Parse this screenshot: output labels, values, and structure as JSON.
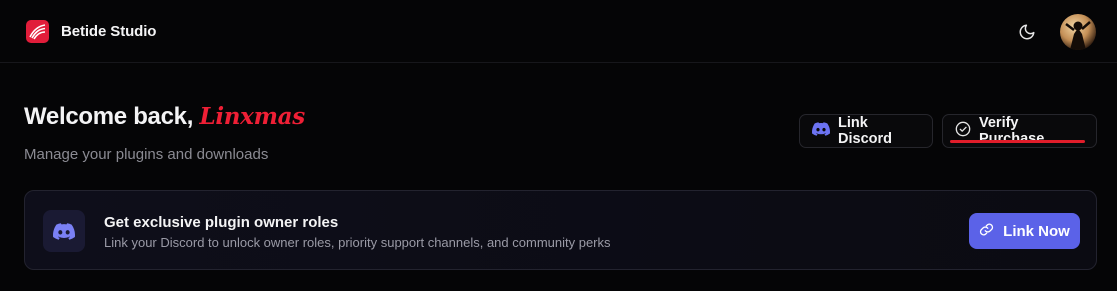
{
  "header": {
    "brand": "Betide Studio",
    "icons": {
      "logo": "betide-logo-icon",
      "theme": "moon-icon",
      "avatar": "user-avatar"
    },
    "brand_color": "#e11d3a"
  },
  "welcome": {
    "greeting": "Welcome back,",
    "username": "Linxmas",
    "subtitle": "Manage your plugins and downloads",
    "username_color": "#ef1f35"
  },
  "actions": {
    "link_discord_label": "Link Discord",
    "verify_purchase_label": "Verify Purchase",
    "icons": {
      "discord": "discord-icon",
      "verify": "check-circle-icon"
    }
  },
  "banner": {
    "title": "Get exclusive plugin owner roles",
    "description": "Link your Discord to unlock owner roles, priority support channels, and community perks",
    "button_label": "Link Now",
    "button_color": "#5b62e8",
    "icons": {
      "discord": "discord-icon",
      "link": "link-icon"
    }
  }
}
